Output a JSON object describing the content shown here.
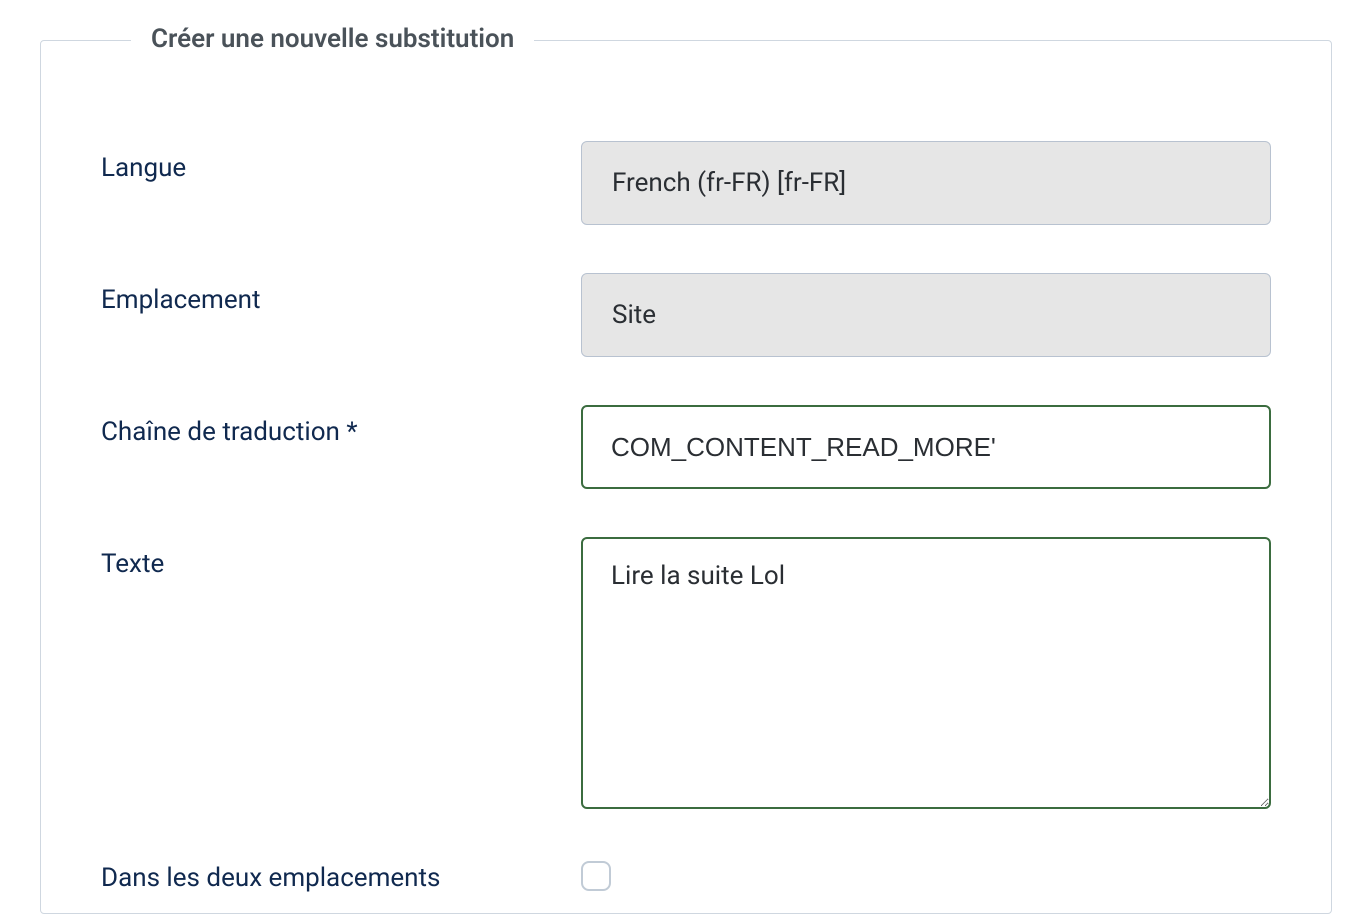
{
  "fieldset": {
    "legend": "Créer une nouvelle substitution"
  },
  "fields": {
    "language": {
      "label": "Langue",
      "value": "French (fr-FR) [fr-FR]"
    },
    "location": {
      "label": "Emplacement",
      "value": "Site"
    },
    "key": {
      "label": "Chaîne de traduction *",
      "value": "COM_CONTENT_READ_MORE'"
    },
    "text": {
      "label": "Texte",
      "value": "Lire la suite Lol"
    },
    "both": {
      "label": "Dans les deux emplacements",
      "checked": false
    }
  }
}
